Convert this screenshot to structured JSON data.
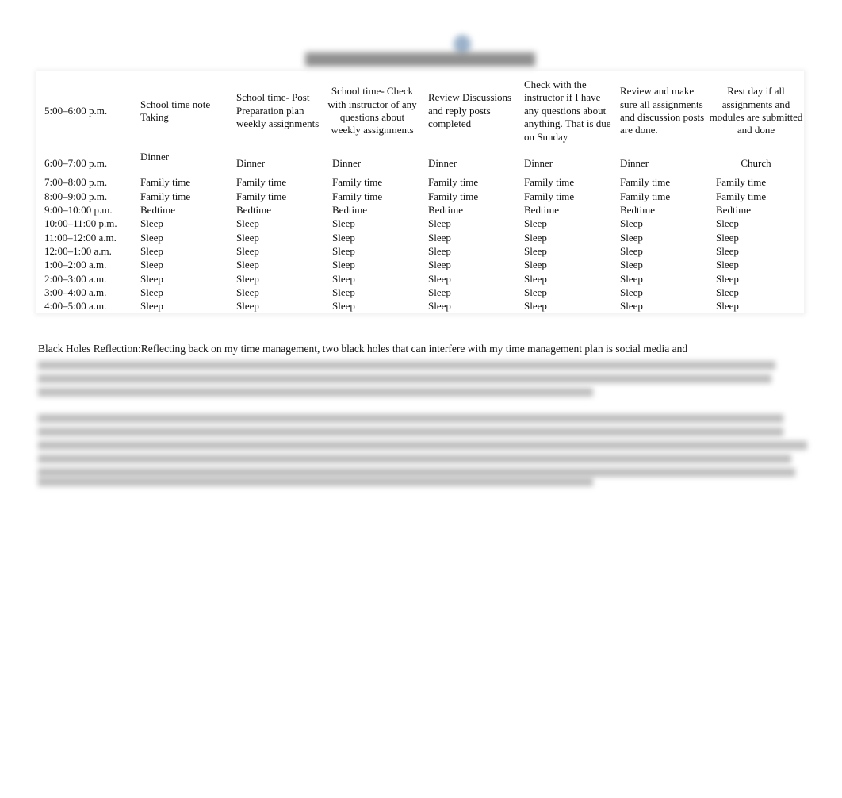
{
  "document": {
    "title_redacted": "Sample Time Management Schedule",
    "table": {
      "head_row": {
        "time": "5:00–6:00 p.m.",
        "cells": [
          "School time note Taking",
          "School time- Post Preparation plan weekly assignments",
          "School time- Check with instructor of any questions about weekly assignments",
          "Review Discussions and reply posts completed",
          "Check with the instructor if I have any questions about anything. That is due on Sunday",
          "Review and make sure all assignments and discussion posts are done.",
          "Rest day if all assignments and modules are submitted and done"
        ]
      },
      "dinner_row": {
        "time": "6:00–7:00 p.m.",
        "cells": [
          "Dinner",
          "Dinner",
          "Dinner",
          "Dinner",
          "Dinner",
          "Dinner",
          "Church"
        ]
      },
      "rows": [
        {
          "time": "7:00–8:00 p.m.",
          "activity": "Family time"
        },
        {
          "time": "8:00–9:00 p.m.",
          "activity": "Family time"
        },
        {
          "time": "9:00–10:00 p.m.",
          "activity": "Bedtime"
        },
        {
          "time": "10:00–11:00 p.m.",
          "activity": "Sleep"
        },
        {
          "time": "11:00–12:00 a.m.",
          "activity": "Sleep"
        },
        {
          "time": "12:00–1:00 a.m.",
          "activity": "Sleep"
        },
        {
          "time": "1:00–2:00 a.m.",
          "activity": "Sleep"
        },
        {
          "time": "2:00–3:00 a.m.",
          "activity": "Sleep"
        },
        {
          "time": "3:00–4:00 a.m.",
          "activity": "Sleep"
        },
        {
          "time": "4:00–5:00 a.m.",
          "activity": "Sleep"
        }
      ]
    },
    "reflection": {
      "label": "Black Holes Reflection:",
      "text": "Reflecting back on my time management, two black holes that can interfere with my time management plan is social media and"
    }
  }
}
